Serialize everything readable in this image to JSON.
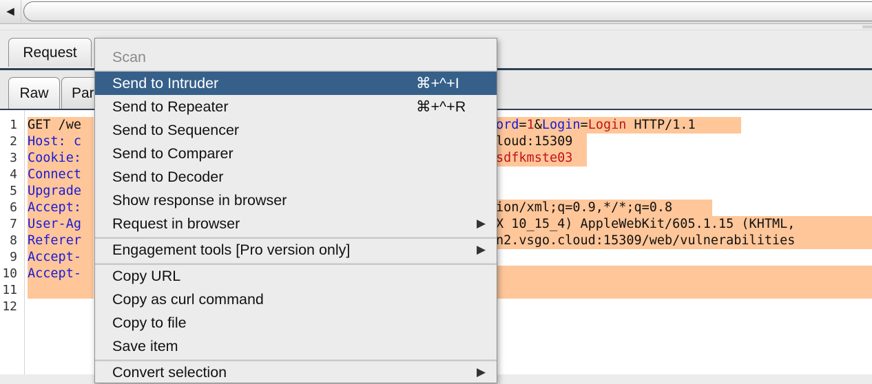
{
  "tabs": {
    "main": [
      {
        "label": "Request"
      }
    ],
    "editor_tabs": [
      {
        "label": "Raw"
      },
      {
        "label": "Par"
      }
    ]
  },
  "editor": {
    "line_numbers": [
      "1",
      "2",
      "3",
      "4",
      "5",
      "6",
      "7",
      "8",
      "9",
      "10",
      "11",
      "12"
    ],
    "lines": [
      {
        "left": "GET /we",
        "right_parts": [
          {
            "t": "ord",
            "c": "blue"
          },
          {
            "t": "=",
            "c": "black"
          },
          {
            "t": "1",
            "c": "red"
          },
          {
            "t": "&",
            "c": "black"
          },
          {
            "t": "Login",
            "c": "blue"
          },
          {
            "t": "=",
            "c": "black"
          },
          {
            "t": "Login",
            "c": "red"
          },
          {
            "t": " HTTP/1.1",
            "c": "black"
          }
        ]
      },
      {
        "left": "Host: c",
        "right": "loud:15309"
      },
      {
        "left": "Cookie:",
        "right": "sdfkmste03"
      },
      {
        "left": "Connect",
        "right": ""
      },
      {
        "left": "Upgrade",
        "right": ""
      },
      {
        "left": "Accept:",
        "right": "ion/xml;q=0.9,*/*;q=0.8"
      },
      {
        "left": "User-Ag",
        "right": "X 10_15_4) AppleWebKit/605.1.15 (KHTML,"
      },
      {
        "left": "Referer",
        "right": "n2.vsgo.cloud:15309/web/vulnerabilities"
      },
      {
        "left": "Accept-",
        "right": ""
      },
      {
        "left": "Accept-",
        "right": ""
      }
    ]
  },
  "context_menu": {
    "items": [
      {
        "label": "Scan",
        "disabled": true
      },
      {
        "label": "Send to Intruder",
        "shortcut": "⌘+^+I",
        "selected": true
      },
      {
        "label": "Send to Repeater",
        "shortcut": "⌘+^+R"
      },
      {
        "label": "Send to Sequencer"
      },
      {
        "label": "Send to Comparer"
      },
      {
        "label": "Send to Decoder"
      },
      {
        "label": "Show response in browser"
      },
      {
        "label": "Request in browser",
        "submenu": true
      },
      {
        "label": "Engagement tools [Pro version only]",
        "submenu": true
      },
      {
        "label": "Copy URL"
      },
      {
        "label": "Copy as curl command"
      },
      {
        "label": "Copy to file"
      },
      {
        "label": "Save item"
      },
      {
        "label": "Convert selection",
        "submenu": true
      }
    ],
    "arrow_glyph": "▶"
  },
  "icons": {
    "scroll_left": "◀"
  },
  "colors": {
    "selected_bg": "#36608a",
    "highlight_bg": "#ffc699",
    "param_name": "#1a1ad6",
    "param_value": "#c0141a"
  }
}
